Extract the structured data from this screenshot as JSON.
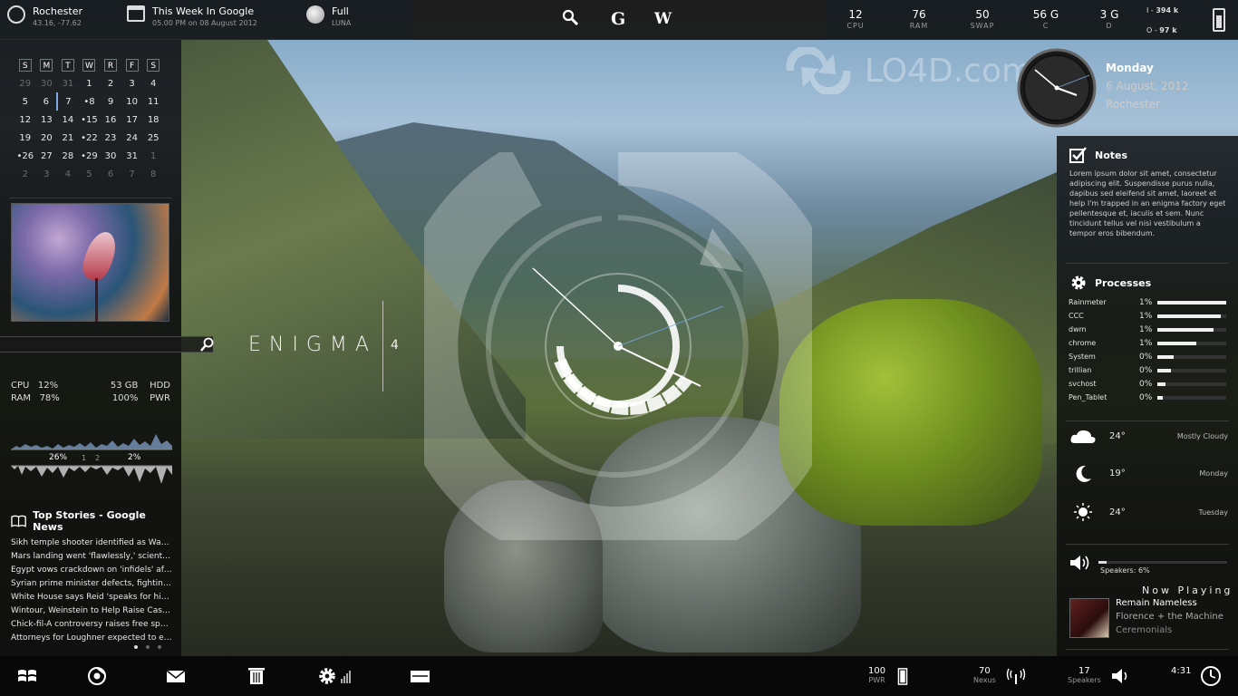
{
  "topbar": {
    "location": {
      "name": "Rochester",
      "coords": "43.16, -77.62"
    },
    "calendar": {
      "title": "This Week In Google",
      "subtitle": "05.00 PM on 08 August 2012"
    },
    "moon": {
      "phase": "Full",
      "label": "LUNA"
    },
    "search_buttons": {
      "google": "G",
      "wikipedia": "W"
    },
    "stats": [
      {
        "value": "12",
        "label": "CPU"
      },
      {
        "value": "76",
        "label": "RAM"
      },
      {
        "value": "50",
        "label": "SWAP"
      },
      {
        "value": "56 G",
        "label": "C"
      },
      {
        "value": "3 G",
        "label": "D"
      }
    ],
    "net": {
      "in_label": "I -",
      "in_value": "394 k",
      "out_label": "O -",
      "out_value": "97 k"
    }
  },
  "calendar": {
    "weekdays": [
      "S",
      "M",
      "T",
      "W",
      "R",
      "F",
      "S"
    ],
    "weeks": [
      [
        {
          "d": "29",
          "dim": true
        },
        {
          "d": "30",
          "dim": true
        },
        {
          "d": "31",
          "dim": true
        },
        {
          "d": "1"
        },
        {
          "d": "2"
        },
        {
          "d": "3"
        },
        {
          "d": "4"
        }
      ],
      [
        {
          "d": "5"
        },
        {
          "d": "6",
          "today": true
        },
        {
          "d": "7"
        },
        {
          "d": "•8"
        },
        {
          "d": "9"
        },
        {
          "d": "10"
        },
        {
          "d": "11"
        }
      ],
      [
        {
          "d": "12"
        },
        {
          "d": "13"
        },
        {
          "d": "14"
        },
        {
          "d": "•15"
        },
        {
          "d": "16"
        },
        {
          "d": "17"
        },
        {
          "d": "18"
        }
      ],
      [
        {
          "d": "19"
        },
        {
          "d": "20"
        },
        {
          "d": "21"
        },
        {
          "d": "•22"
        },
        {
          "d": "23"
        },
        {
          "d": "24"
        },
        {
          "d": "25"
        }
      ],
      [
        {
          "d": "•26"
        },
        {
          "d": "27"
        },
        {
          "d": "28"
        },
        {
          "d": "•29"
        },
        {
          "d": "30"
        },
        {
          "d": "31"
        },
        {
          "d": "1",
          "dim": true
        }
      ],
      [
        {
          "d": "2",
          "dim": true
        },
        {
          "d": "3",
          "dim": true
        },
        {
          "d": "4",
          "dim": true
        },
        {
          "d": "5",
          "dim": true
        },
        {
          "d": "6",
          "dim": true
        },
        {
          "d": "7",
          "dim": true
        },
        {
          "d": "8",
          "dim": true
        }
      ]
    ]
  },
  "sysinfo": {
    "cpu_label": "CPU",
    "cpu_value": "12%",
    "ram_label": "RAM",
    "ram_value": "78%",
    "hdd_value": "53 GB",
    "hdd_label": "HDD",
    "pwr_value": "100%",
    "pwr_label": "PWR",
    "graph_left": "26%",
    "graph_mid1": "1",
    "graph_mid2": "2",
    "graph_right": "2%"
  },
  "news": {
    "title": "Top Stories - Google News",
    "items": [
      "Sikh temple shooter identified as Wade Michael Page",
      "Mars landing went 'flawlessly,' scientists say",
      "Egypt vows crackdown on 'infidels' after attack",
      "Syrian prime minister defects, fighting rages",
      "White House says Reid 'speaks for himself'",
      "Wintour, Weinstein to Help Raise Cash for Obama",
      "Chick-fil-A controversy raises free speech questions",
      "Attorneys for Loughner expected to enter guilty plea"
    ]
  },
  "enigma": {
    "title": "ENIGMA",
    "version": "4"
  },
  "clock": {
    "day": "Monday",
    "date": "6 August, 2012",
    "city": "Rochester"
  },
  "notes": {
    "title": "Notes",
    "text": "Lorem ipsum dolor sit amet, consectetur adipiscing elit. Suspendisse purus nulla, dapibus sed eleifend sit amet, laoreet et help I'm trapped in an enigma factory eget pellentesque et, iaculis et sem. Nunc tincidunt tellus vel nisi vestibulum a tempor eros bibendum."
  },
  "processes": {
    "title": "Processes",
    "items": [
      {
        "name": "Rainmeter",
        "pct": "1%",
        "level": 1.0
      },
      {
        "name": "CCC",
        "pct": "1%",
        "level": 0.92
      },
      {
        "name": "dwm",
        "pct": "1%",
        "level": 0.82
      },
      {
        "name": "chrome",
        "pct": "1%",
        "level": 0.56
      },
      {
        "name": "System",
        "pct": "0%",
        "level": 0.24
      },
      {
        "name": "trillian",
        "pct": "0%",
        "level": 0.2
      },
      {
        "name": "svchost",
        "pct": "0%",
        "level": 0.12
      },
      {
        "name": "Pen_Tablet",
        "pct": "0%",
        "level": 0.08
      }
    ]
  },
  "weather": [
    {
      "icon": "cloud-icon",
      "temp": "24°",
      "caption": "Mostly Cloudy"
    },
    {
      "icon": "moon-icon",
      "temp": "19°",
      "caption": "Monday"
    },
    {
      "icon": "sun-icon",
      "temp": "24°",
      "caption": "Tuesday"
    }
  ],
  "volume": {
    "label": "Speakers: 6%",
    "level": 0.06
  },
  "now_playing": {
    "title": "Now Playing",
    "track": "Remain Nameless",
    "artist": "Florence + the Machine",
    "album": "Ceremonials"
  },
  "bottombar": {
    "power": {
      "value": "100",
      "label": "PWR"
    },
    "wifi": {
      "value": "70",
      "label": "Nexus"
    },
    "speakers": {
      "value": "17",
      "label": "Speakers"
    },
    "time": "4:31"
  },
  "watermark": "LO4D.com"
}
